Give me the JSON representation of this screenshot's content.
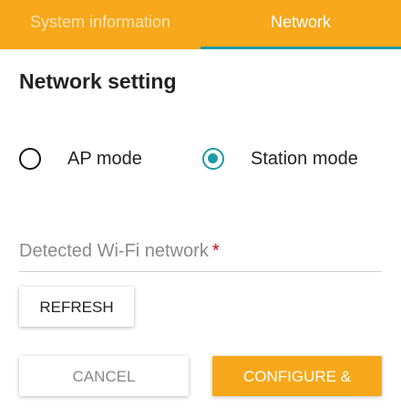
{
  "tabs": {
    "system_information": "System information",
    "network": "Network"
  },
  "network_setting": {
    "title": "Network setting",
    "ap_mode_label": "AP mode",
    "station_mode_label": "Station mode",
    "selected_mode": "Station mode"
  },
  "wifi_field": {
    "label": "Detected Wi-Fi network",
    "required_mark": "*"
  },
  "buttons": {
    "refresh": "REFRESH",
    "cancel": "CANCEL",
    "configure": "CONFIGURE &"
  },
  "colors": {
    "accent_orange": "#f7a81b",
    "accent_teal": "#1f9aa6",
    "required_red": "#d0021b"
  }
}
